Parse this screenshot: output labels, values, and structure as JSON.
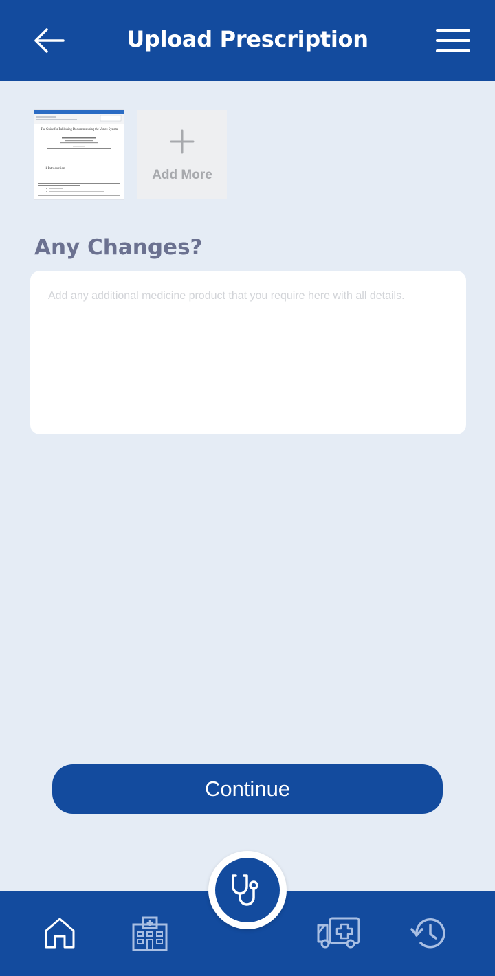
{
  "header": {
    "title": "Upload Prescription",
    "back_icon": "arrow-left-icon",
    "menu_icon": "hamburger-menu-icon"
  },
  "attachments": {
    "thumbnail": {
      "doc_title": "The Guide for Publishing Documents using the Vortex System",
      "section_heading": "1 Introduction"
    },
    "add_more_label": "Add More",
    "add_more_icon": "plus-icon"
  },
  "changes": {
    "label": "Any Changes?",
    "placeholder": "Add any additional medicine product that you require here with all details.",
    "value": ""
  },
  "continue_label": "Continue",
  "bottom_nav": {
    "items": [
      {
        "icon": "home-icon"
      },
      {
        "icon": "hospital-icon"
      },
      {
        "icon": "stethoscope-icon"
      },
      {
        "icon": "ambulance-icon"
      },
      {
        "icon": "history-icon"
      }
    ]
  },
  "colors": {
    "primary": "#134b9e",
    "background": "#e5ecf5",
    "label": "#6b7190"
  }
}
